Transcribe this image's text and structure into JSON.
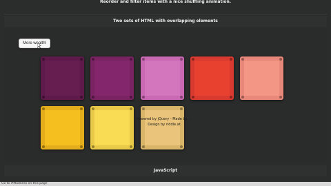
{
  "top_caption": "Reorder and filter items with a nice shuffling animation.",
  "section_title": "Two sets of HTML with overlapping elements",
  "more_button_label": "More wealth!",
  "tiles": [
    {
      "name": "tile-1",
      "color": "#5e1a4a",
      "inner": "#661d50"
    },
    {
      "name": "tile-2",
      "color": "#7a2363",
      "inner": "#84266b"
    },
    {
      "name": "tile-3",
      "color": "#c968b3",
      "inner": "#d476bd"
    },
    {
      "name": "tile-4",
      "color": "#d93a30",
      "inner": "#e8412f"
    },
    {
      "name": "tile-5",
      "color": "#e8887a",
      "inner": "#f39686"
    },
    {
      "name": "tile-6",
      "color": "#e3ad1c",
      "inner": "#f5bf20"
    },
    {
      "name": "tile-7",
      "color": "#e8c948",
      "inner": "#f9dc54"
    },
    {
      "name": "tile-8",
      "color": "#d9b569",
      "inner": "#e9c47a"
    }
  ],
  "overlay": {
    "line1": "Powered by jQuery - Made by ...",
    "line2": "Design by riddle.at"
  },
  "footer_title": "JavaScript",
  "status_text": "Go to #Madness on this page"
}
